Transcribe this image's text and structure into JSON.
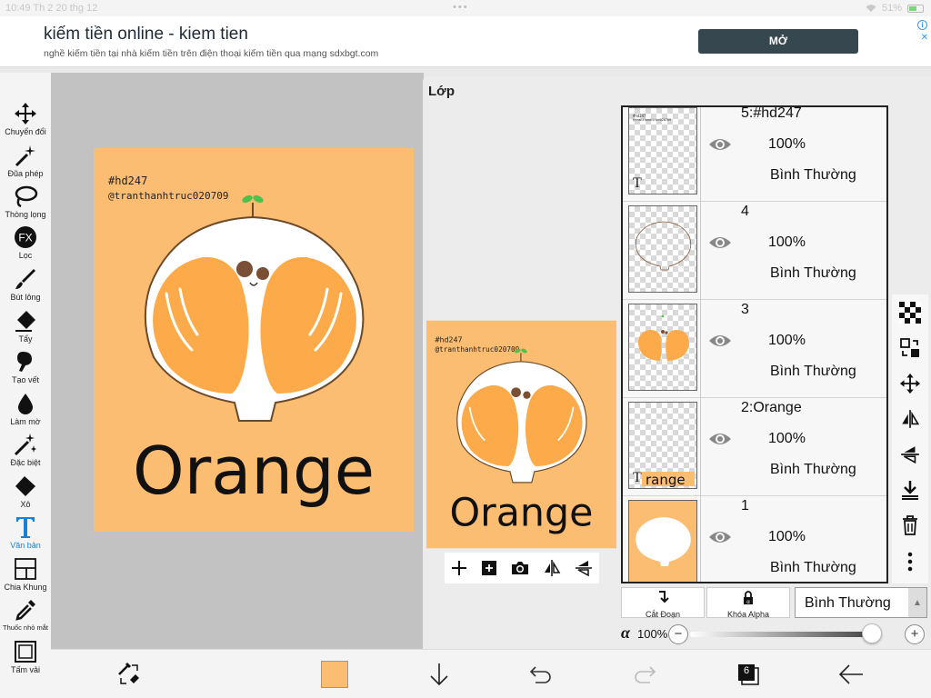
{
  "statusbar": {
    "time": "10:49",
    "date": "Th 2 20 thg 12",
    "battery": "51%"
  },
  "ad": {
    "title": "kiếm tiền online - kiem tien",
    "subtitle": "nghề kiếm tiền tại nhà kiếm tiền trên điện thoại kiếm tiền qua mạng sdxbgt.com",
    "open_button": "MỞ"
  },
  "tools": [
    {
      "label": "Chuyển đổi",
      "icon": "move-icon"
    },
    {
      "label": "Đũa phép",
      "icon": "magic-wand-icon"
    },
    {
      "label": "Thòng lọng",
      "icon": "lasso-icon"
    },
    {
      "label": "Lọc",
      "icon": "fx-icon"
    },
    {
      "label": "Bút lông",
      "icon": "brush-icon"
    },
    {
      "label": "Tẩy",
      "icon": "eraser-icon"
    },
    {
      "label": "Tạo vết",
      "icon": "smudge-icon"
    },
    {
      "label": "Làm mờ",
      "icon": "blur-icon"
    },
    {
      "label": "Đặc biệt",
      "icon": "special-icon"
    },
    {
      "label": "Xô",
      "icon": "bucket-icon"
    },
    {
      "label": "Văn bản",
      "icon": "text-icon",
      "active": true
    },
    {
      "label": "Chia Khung",
      "icon": "frame-divider-icon"
    },
    {
      "label": "Thuốc nhỏ mắt",
      "icon": "eyedropper-icon"
    },
    {
      "label": "Tấm vải",
      "icon": "canvas-icon"
    }
  ],
  "artwork": {
    "hashtag": "#hd247",
    "handle": "@tranthanhtruc020709",
    "word": "Orange",
    "background_color": "#fbbd72",
    "fruit_color": "#fdab4a"
  },
  "layer_panel": {
    "title": "Lớp",
    "layers": [
      {
        "name": "5:#hd247",
        "opacity": "100%",
        "blend": "Bình Thường"
      },
      {
        "name": "4",
        "opacity": "100%",
        "blend": "Bình Thường"
      },
      {
        "name": "3",
        "opacity": "100%",
        "blend": "Bình Thường"
      },
      {
        "name": "2:Orange",
        "opacity": "100%",
        "blend": "Bình Thường",
        "thumb_text": "range"
      },
      {
        "name": "1",
        "opacity": "100%",
        "blend": "Bình Thường"
      }
    ],
    "clipping_label": "Cắt Đoạn",
    "alpha_lock_label": "Khóa Alpha",
    "blend_mode": "Bình Thường",
    "alpha_value": "100%",
    "alpha_fraction": 1.0
  },
  "bottombar": {
    "layer_count": "6"
  }
}
